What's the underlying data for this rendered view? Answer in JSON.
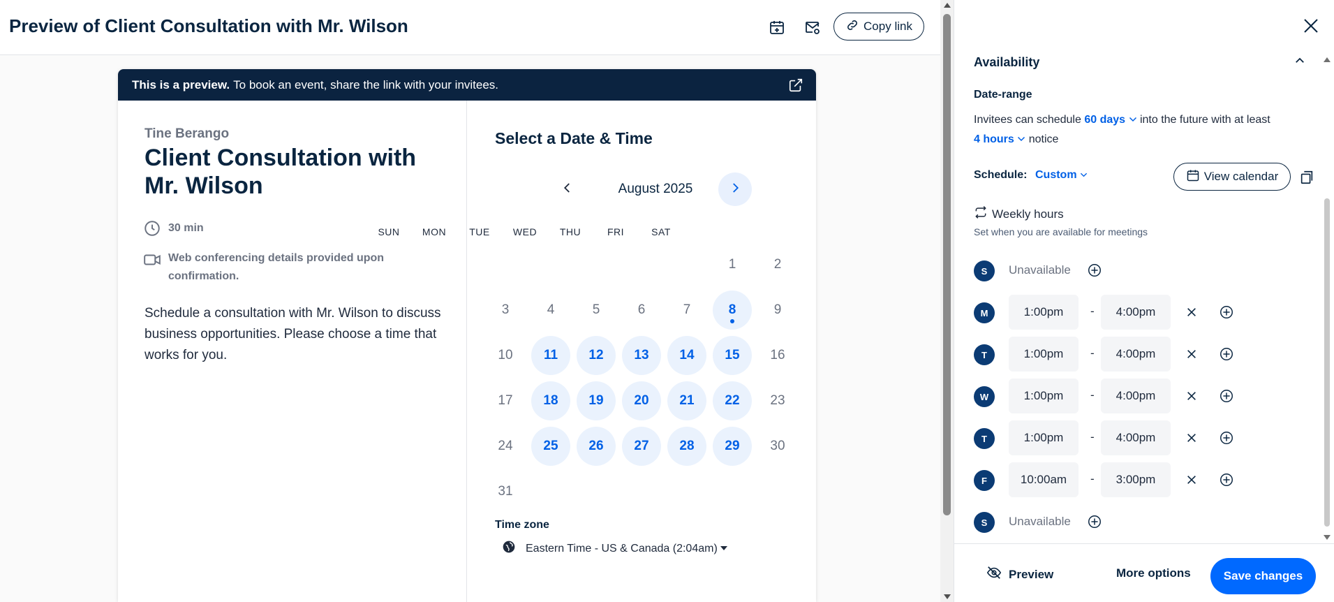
{
  "preview": {
    "title": "Preview of Client Consultation with Mr. Wilson",
    "copy_link": "Copy link",
    "icons": [
      "add-to-calendar-icon",
      "email-settings-icon",
      "link-icon",
      "open-external-icon"
    ]
  },
  "banner": {
    "bold": "This is a preview.",
    "text": "To book an event, share the link with your invitees."
  },
  "event": {
    "host": "Tine Berango",
    "title": "Client Consultation with Mr. Wilson",
    "duration": "30 min",
    "conferencing": "Web conferencing details provided upon confirmation.",
    "description": "Schedule a consultation with Mr. Wilson to discuss business opportunities. Please choose a time that works for you."
  },
  "calendar": {
    "heading": "Select a Date & Time",
    "month": "August 2025",
    "weekdays": [
      "SUN",
      "MON",
      "TUE",
      "WED",
      "THU",
      "FRI",
      "SAT"
    ],
    "first_weekday_index": 5,
    "days_in_month": 31,
    "available_days": [
      8,
      11,
      12,
      13,
      14,
      15,
      18,
      19,
      20,
      21,
      22,
      25,
      26,
      27,
      28,
      29
    ],
    "today": 8,
    "timezone_label": "Time zone",
    "timezone_value": "Eastern Time - US & Canada (2:04am)"
  },
  "panel": {
    "section": "Availability",
    "date_range_heading": "Date-range",
    "range_prefix": "Invitees can schedule",
    "range_days": "60 days",
    "range_middle": "into the future with at least",
    "range_notice": "4 hours",
    "range_suffix": "notice",
    "schedule_label": "Schedule:",
    "schedule_value": "Custom",
    "view_calendar": "View calendar",
    "weekly_hours": "Weekly hours",
    "weekly_sub": "Set when you are available for meetings",
    "unavailable_text": "Unavailable",
    "dash": "-",
    "days": [
      {
        "letter": "S",
        "unavailable": true
      },
      {
        "letter": "M",
        "start": "1:00pm",
        "end": "4:00pm"
      },
      {
        "letter": "T",
        "start": "1:00pm",
        "end": "4:00pm"
      },
      {
        "letter": "W",
        "start": "1:00pm",
        "end": "4:00pm"
      },
      {
        "letter": "T",
        "start": "1:00pm",
        "end": "4:00pm"
      },
      {
        "letter": "F",
        "start": "10:00am",
        "end": "3:00pm"
      },
      {
        "letter": "S",
        "unavailable": true
      }
    ],
    "footer": {
      "preview": "Preview",
      "more_options": "More options",
      "save": "Save changes"
    }
  },
  "colors": {
    "brand_blue": "#0069ff",
    "link_blue": "#0060e6",
    "navy": "#0b2340",
    "day_badge": "#0b3b74",
    "available_bg": "#eaf2fd"
  }
}
